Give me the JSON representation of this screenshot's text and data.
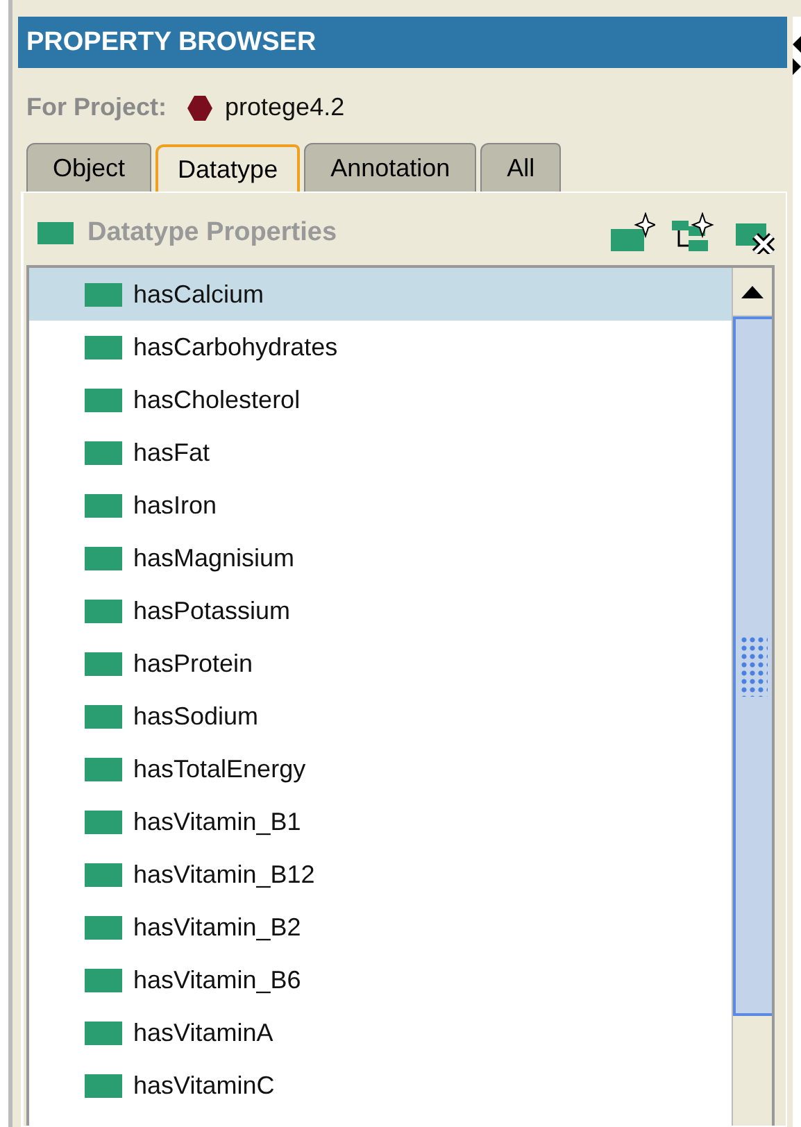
{
  "panel": {
    "title": "PROPERTY BROWSER",
    "project_label": "For Project:",
    "project_name": "protege4.2"
  },
  "tabs": [
    {
      "label": "Object",
      "selected": false
    },
    {
      "label": "Datatype",
      "selected": true
    },
    {
      "label": "Annotation",
      "selected": false
    },
    {
      "label": "All",
      "selected": false
    }
  ],
  "section": {
    "title": "Datatype Properties"
  },
  "properties": [
    {
      "name": "hasCalcium",
      "selected": true
    },
    {
      "name": "hasCarbohydrates",
      "selected": false
    },
    {
      "name": "hasCholesterol",
      "selected": false
    },
    {
      "name": "hasFat",
      "selected": false
    },
    {
      "name": "hasIron",
      "selected": false
    },
    {
      "name": "hasMagnisium",
      "selected": false
    },
    {
      "name": "hasPotassium",
      "selected": false
    },
    {
      "name": "hasProtein",
      "selected": false
    },
    {
      "name": "hasSodium",
      "selected": false
    },
    {
      "name": "hasTotalEnergy",
      "selected": false
    },
    {
      "name": "hasVitamin_B1",
      "selected": false
    },
    {
      "name": "hasVitamin_B12",
      "selected": false
    },
    {
      "name": "hasVitamin_B2",
      "selected": false
    },
    {
      "name": "hasVitamin_B6",
      "selected": false
    },
    {
      "name": "hasVitaminA",
      "selected": false
    },
    {
      "name": "hasVitaminC",
      "selected": false
    }
  ]
}
